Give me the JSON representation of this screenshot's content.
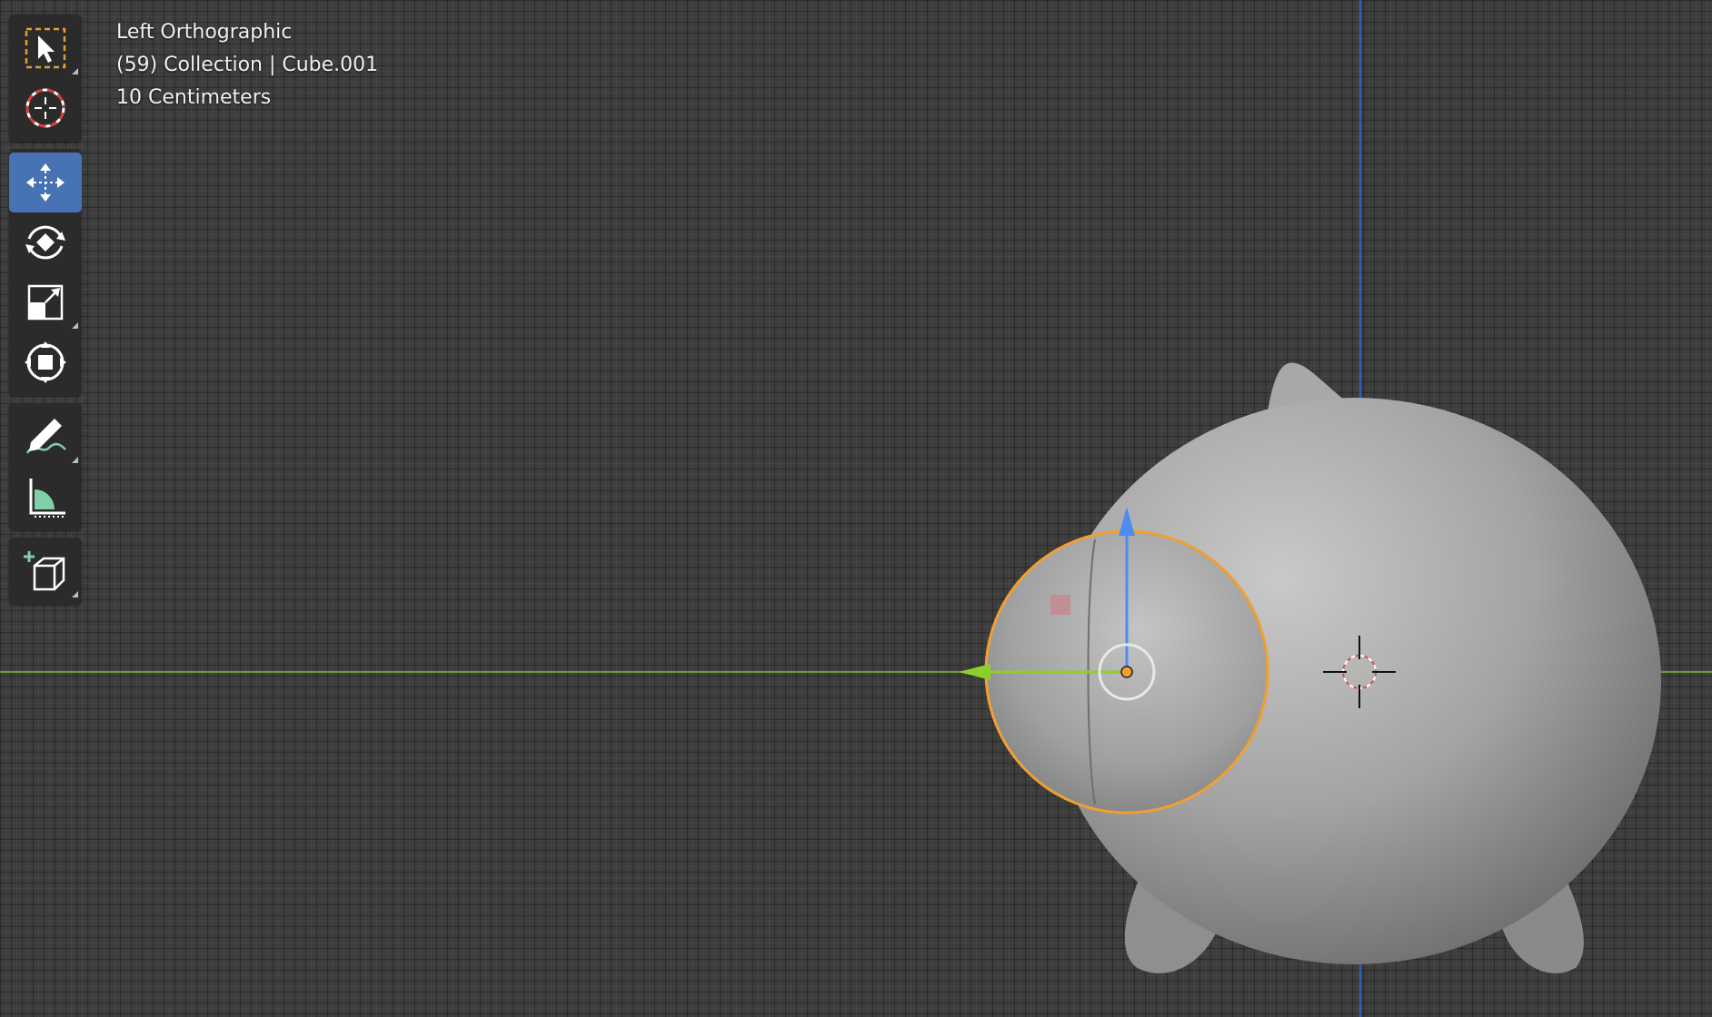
{
  "viewport": {
    "view_name": "Left Orthographic",
    "object_info": "(59) Collection | Cube.001",
    "grid_scale": "10 Centimeters"
  },
  "toolbar": {
    "groups": [
      [
        "select-box-icon",
        "cursor-icon"
      ],
      [
        "move-icon",
        "rotate-icon",
        "scale-icon",
        "transform-icon"
      ],
      [
        "annotate-icon",
        "measure-icon"
      ],
      [
        "add-cube-icon"
      ]
    ],
    "active_tool": "move-icon"
  },
  "colors": {
    "background": "#3d3d3d",
    "y_axis": "#6b9a2e",
    "z_axis": "#2f62b8",
    "selection_outline": "#f0a030",
    "active_tool": "#4772b3",
    "mesh": "#9a9a9a"
  }
}
